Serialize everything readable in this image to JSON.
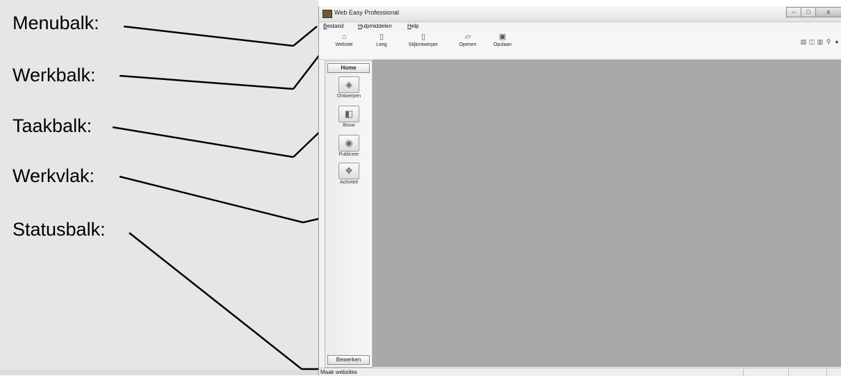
{
  "labels": {
    "menubalk": "Menubalk:",
    "werkbalk": "Werkbalk:",
    "taakbalk": "Taakbalk:",
    "werkvlak": "Werkvlak:",
    "statusbalk": "Statusbalk:"
  },
  "window": {
    "title": "Web Easy Professional",
    "icon": "app-icon"
  },
  "menu": {
    "items": [
      {
        "first": "B",
        "rest": "estand"
      },
      {
        "first": "H",
        "rest": "ulpmiddelen"
      },
      {
        "first": "H",
        "rest": "elp"
      }
    ]
  },
  "toolbar": {
    "buttons": [
      {
        "label": "Website",
        "icon": "website-icon"
      },
      {
        "label": "Leeg",
        "icon": "new-page-icon"
      },
      {
        "label": "Stijlontwerper",
        "icon": "style-designer-icon"
      },
      {
        "label": "Openen",
        "icon": "open-folder-icon"
      },
      {
        "label": "Opslaan",
        "icon": "save-icon"
      }
    ]
  },
  "sidebar": {
    "home": "Home",
    "tasks": [
      {
        "label": "Ontwerpen",
        "icon": "design-icon"
      },
      {
        "label": "Bouw",
        "icon": "build-icon"
      },
      {
        "label": "Publiceer",
        "icon": "publish-icon"
      },
      {
        "label": "Activiteit",
        "icon": "activity-icon"
      }
    ],
    "bottom_button": "Bewerken"
  },
  "statusbar": {
    "text": "Maak websites"
  }
}
